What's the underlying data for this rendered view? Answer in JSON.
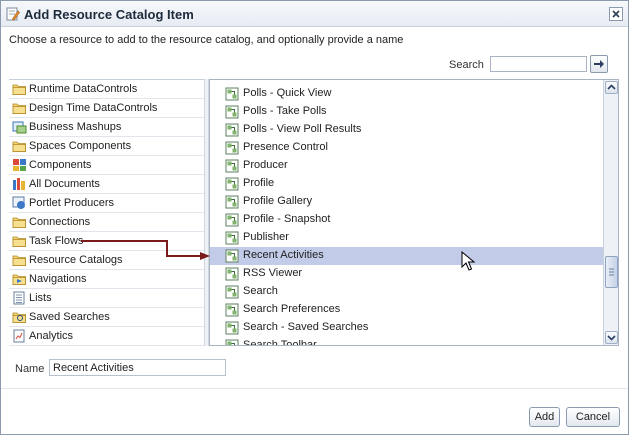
{
  "dialog": {
    "title": "Add Resource Catalog Item",
    "instructions": "Choose a resource to add to the resource catalog, and optionally provide a name"
  },
  "search": {
    "label": "Search",
    "value": ""
  },
  "categories": [
    {
      "label": "Runtime DataControls",
      "icon": "folder-icon"
    },
    {
      "label": "Design Time DataControls",
      "icon": "folder-icon"
    },
    {
      "label": "Business Mashups",
      "icon": "mashup-icon"
    },
    {
      "label": "Spaces Components",
      "icon": "folder-icon"
    },
    {
      "label": "Components",
      "icon": "components-icon"
    },
    {
      "label": "All Documents",
      "icon": "documents-icon"
    },
    {
      "label": "Portlet Producers",
      "icon": "portlet-icon"
    },
    {
      "label": "Connections",
      "icon": "folder-icon"
    },
    {
      "label": "Task Flows",
      "icon": "folder-icon"
    },
    {
      "label": "Resource Catalogs",
      "icon": "folder-icon"
    },
    {
      "label": "Navigations",
      "icon": "navigation-icon"
    },
    {
      "label": "Lists",
      "icon": "list-icon"
    },
    {
      "label": "Saved Searches",
      "icon": "saved-search-icon"
    },
    {
      "label": "Analytics",
      "icon": "analytics-icon"
    }
  ],
  "resources": [
    {
      "label": "Polls - Quick View"
    },
    {
      "label": "Polls - Take Polls"
    },
    {
      "label": "Polls - View Poll Results"
    },
    {
      "label": "Presence Control"
    },
    {
      "label": "Producer"
    },
    {
      "label": "Profile"
    },
    {
      "label": "Profile Gallery"
    },
    {
      "label": "Profile - Snapshot"
    },
    {
      "label": "Publisher"
    },
    {
      "label": "Recent Activities"
    },
    {
      "label": "RSS Viewer"
    },
    {
      "label": "Search"
    },
    {
      "label": "Search Preferences"
    },
    {
      "label": "Search - Saved Searches"
    },
    {
      "label": "Search Toolbar"
    }
  ],
  "selected_resource": "Recent Activities",
  "name_field": {
    "label": "Name",
    "value": "Recent Activities"
  },
  "buttons": {
    "add": "Add",
    "cancel": "Cancel"
  },
  "colors": {
    "selection": "#c2cbe8",
    "arrow": "#7a1a1a",
    "folder": "#f1d374"
  }
}
